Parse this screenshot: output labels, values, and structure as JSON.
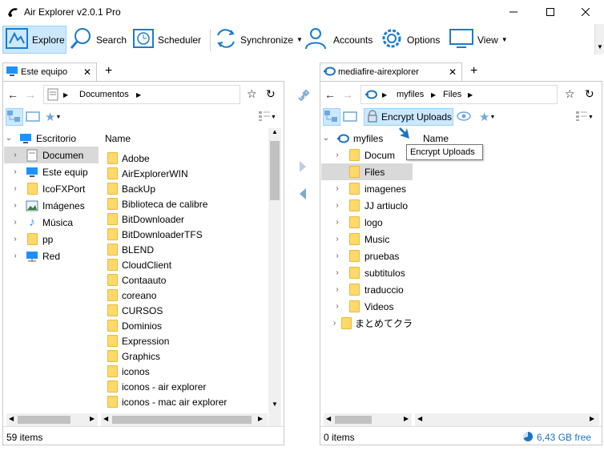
{
  "window": {
    "title": "Air Explorer v2.0.1 Pro"
  },
  "toolbar": {
    "explore": "Explore",
    "search": "Search",
    "scheduler": "Scheduler",
    "synchronize": "Synchronize",
    "accounts": "Accounts",
    "options": "Options",
    "view": "View"
  },
  "left": {
    "tab_label": "Este equipo",
    "breadcrumb": [
      "Documentos"
    ],
    "tree": [
      "Escritorio",
      "Documen",
      "Este equip",
      "IcoFXPort",
      "Imágenes",
      "Música",
      "pp",
      "Red"
    ],
    "column_name": "Name",
    "files": [
      "Adobe",
      "AirExplorerWIN",
      "BackUp",
      "Biblioteca de calibre",
      "BitDownloader",
      "BitDownloaderTFS",
      "BLEND",
      "CloudClient",
      "Contaauto",
      "coreano",
      "CURSOS",
      "Dominios",
      "Expression",
      "Graphics",
      "iconos",
      "iconos - air explorer",
      "iconos - mac air explorer"
    ],
    "status": "59 items"
  },
  "right": {
    "tab_label": "mediafire-airexplorer",
    "breadcrumb": [
      "myfiles",
      "Files"
    ],
    "encrypt_button": "Encrypt Uploads",
    "tooltip": "Encrypt Uploads",
    "tree_root": "myfiles",
    "tree": [
      "Docum",
      "Files",
      "imagenes",
      "JJ artiuclo",
      "logo",
      "Music",
      "pruebas",
      "subtitulos",
      "traduccio",
      "Videos",
      "まとめてクラ"
    ],
    "column_name": "Name",
    "status": "0 items",
    "free_space": "6,43 GB free"
  },
  "colors": {
    "accent": "#0078d7",
    "selection": "#cce8ff",
    "folder": "#ffd96a"
  }
}
